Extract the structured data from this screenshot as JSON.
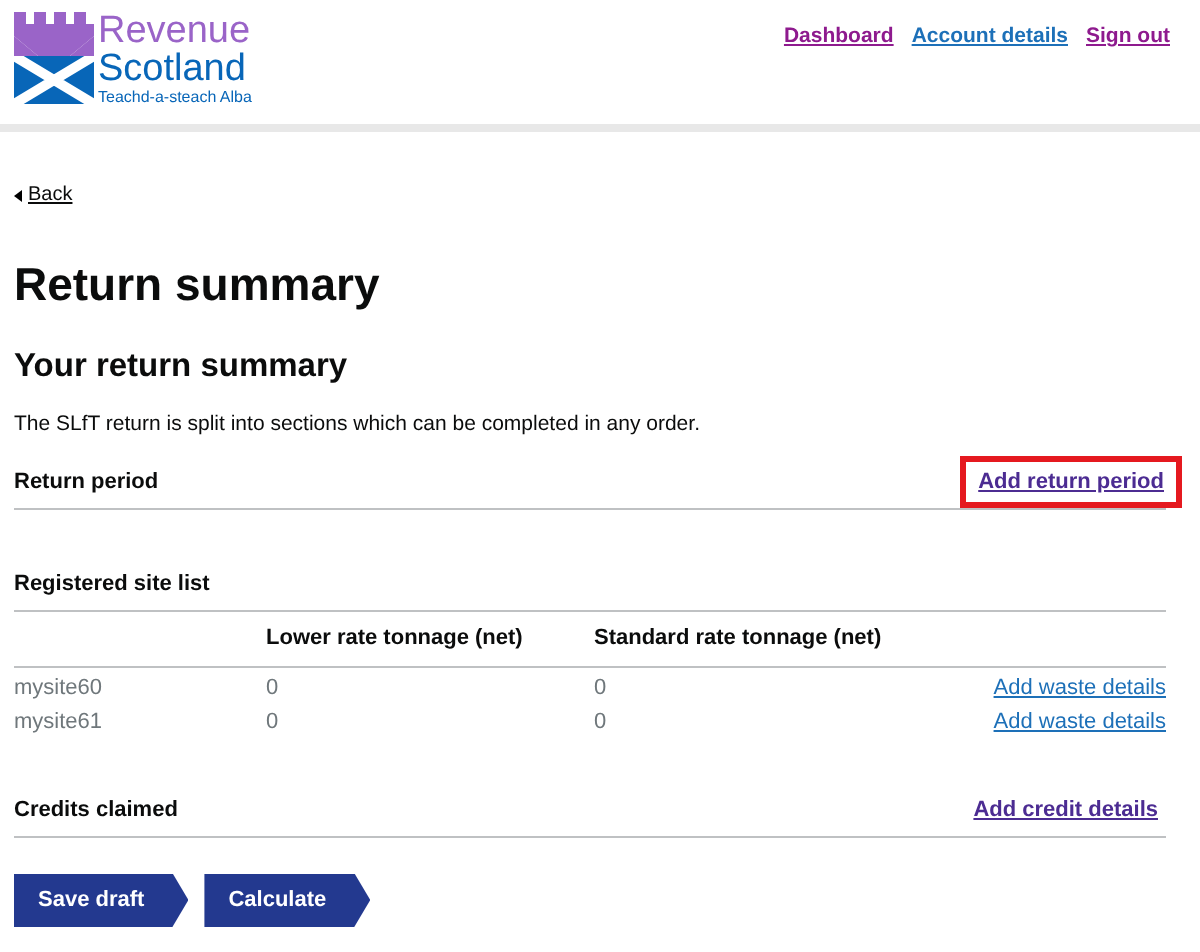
{
  "logo": {
    "line_1": "Revenue",
    "line_2": "Scotland",
    "tagline": "Teachd-a-steach Alba"
  },
  "nav": [
    {
      "label": "Dashboard",
      "visited": true
    },
    {
      "label": "Account details",
      "visited": false
    },
    {
      "label": "Sign out",
      "visited": true
    }
  ],
  "back": "Back",
  "title": "Return summary",
  "subtitle": "Your return summary",
  "intro": "The SLfT return is split into sections which can be completed in any order.",
  "return_period": {
    "label": "Return period",
    "action": "Add return period",
    "highlighted": true
  },
  "sites": {
    "label": "Registered site list",
    "columns": [
      "Lower rate tonnage (net)",
      "Standard rate tonnage (net)"
    ],
    "rows": [
      {
        "name": "mysite60",
        "lower": "0",
        "standard": "0",
        "action": "Add waste details"
      },
      {
        "name": "mysite61",
        "lower": "0",
        "standard": "0",
        "action": "Add waste details"
      }
    ]
  },
  "credits": {
    "label": "Credits claimed",
    "action": "Add credit details"
  },
  "buttons": [
    "Save draft",
    "Calculate"
  ]
}
